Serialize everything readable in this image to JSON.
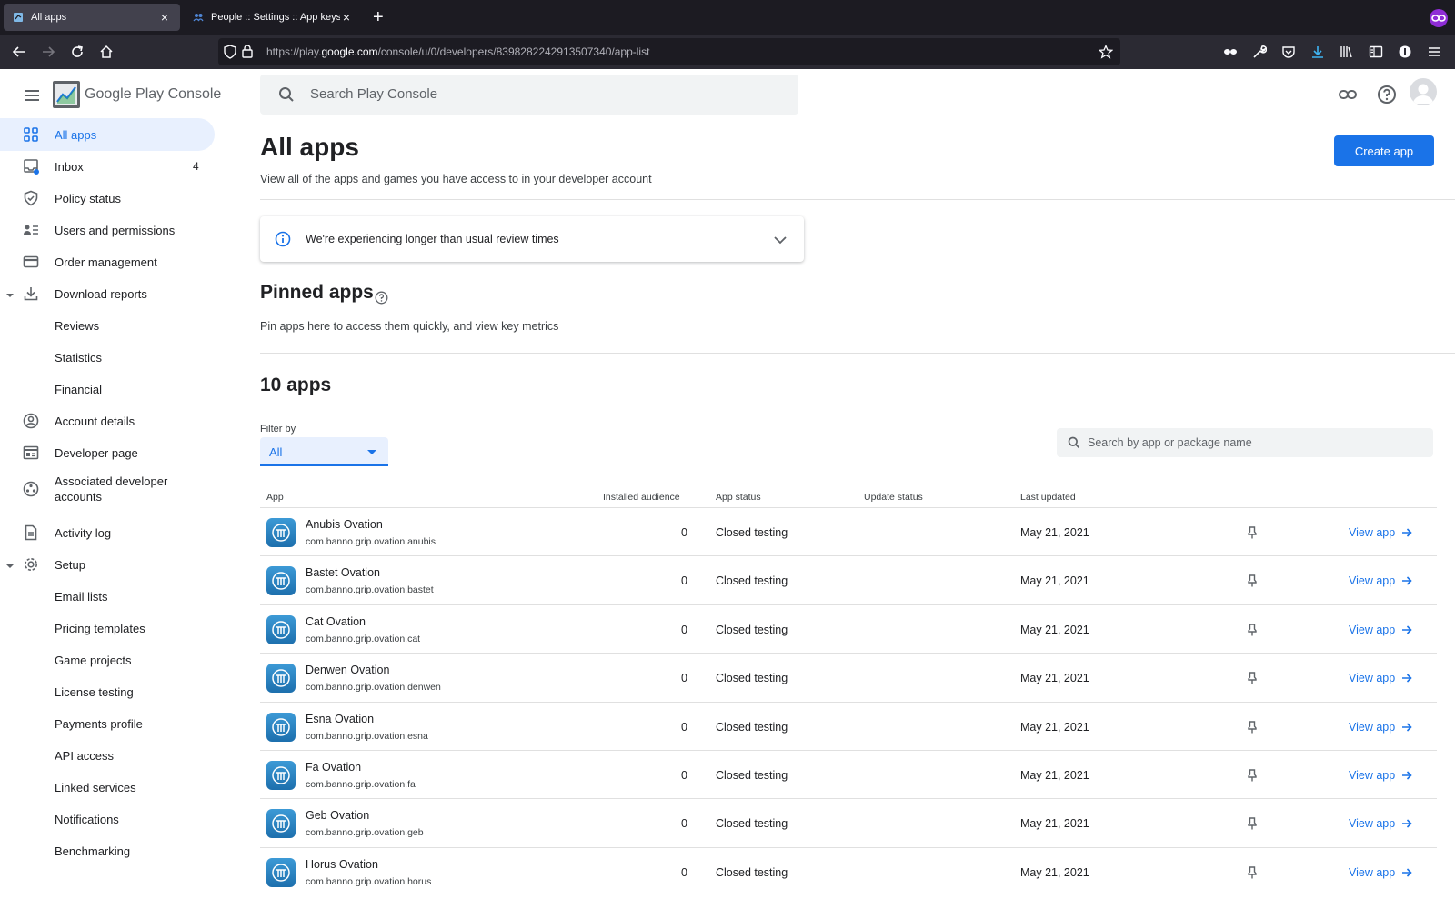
{
  "browser": {
    "tabs": [
      {
        "title": "All apps",
        "active": true
      },
      {
        "title": "People :: Settings :: App keys",
        "active": false
      }
    ],
    "url": {
      "prefix": "https://play.",
      "domain": "google.com",
      "path": "/console/u/0/developers/8398282242913507340/app-list"
    }
  },
  "header": {
    "logo_text": "Google Play Console",
    "search_placeholder": "Search Play Console"
  },
  "sidebar": {
    "items": [
      {
        "label": "All apps",
        "icon": "grid-icon",
        "active": true
      },
      {
        "label": "Inbox",
        "icon": "inbox-icon",
        "count": "4"
      },
      {
        "label": "Policy status",
        "icon": "shield-icon"
      },
      {
        "label": "Users and permissions",
        "icon": "users-icon"
      },
      {
        "label": "Order management",
        "icon": "credit-card-icon"
      },
      {
        "label": "Download reports",
        "icon": "download-icon",
        "expanded": true
      },
      {
        "label": "Reviews",
        "sub": true
      },
      {
        "label": "Statistics",
        "sub": true
      },
      {
        "label": "Financial",
        "sub": true
      },
      {
        "label": "Account details",
        "icon": "account-circle-icon"
      },
      {
        "label": "Developer page",
        "icon": "web-page-icon"
      },
      {
        "label": "Associated developer accounts",
        "icon": "associated-accounts-icon"
      },
      {
        "label": "Activity log",
        "icon": "document-icon"
      },
      {
        "label": "Setup",
        "icon": "gear-icon",
        "expanded": true
      },
      {
        "label": "Email lists",
        "sub": true
      },
      {
        "label": "Pricing templates",
        "sub": true
      },
      {
        "label": "Game projects",
        "sub": true
      },
      {
        "label": "License testing",
        "sub": true
      },
      {
        "label": "Payments profile",
        "sub": true
      },
      {
        "label": "API access",
        "sub": true
      },
      {
        "label": "Linked services",
        "sub": true
      },
      {
        "label": "Notifications",
        "sub": true
      },
      {
        "label": "Benchmarking",
        "sub": true
      }
    ]
  },
  "main": {
    "title": "All apps",
    "subtitle": "View all of the apps and games you have access to in your developer account",
    "create_button": "Create app",
    "banner": "We're experiencing longer than usual review times",
    "pinned_title": "Pinned apps",
    "pinned_subtitle": "Pin apps here to access them quickly, and view key metrics",
    "apps_count": "10 apps",
    "filter_label": "Filter by",
    "filter_value": "All",
    "table_search_placeholder": "Search by app or package name",
    "columns": [
      "App",
      "Installed audience",
      "App status",
      "Update status",
      "Last updated"
    ],
    "view_label": "View app",
    "rows": [
      {
        "name": "Anubis Ovation",
        "package": "com.banno.grip.ovation.anubis",
        "audience": "0",
        "status": "Closed testing",
        "update_status": "",
        "updated": "May 21, 2021"
      },
      {
        "name": "Bastet Ovation",
        "package": "com.banno.grip.ovation.bastet",
        "audience": "0",
        "status": "Closed testing",
        "update_status": "",
        "updated": "May 21, 2021"
      },
      {
        "name": "Cat Ovation",
        "package": "com.banno.grip.ovation.cat",
        "audience": "0",
        "status": "Closed testing",
        "update_status": "",
        "updated": "May 21, 2021"
      },
      {
        "name": "Denwen Ovation",
        "package": "com.banno.grip.ovation.denwen",
        "audience": "0",
        "status": "Closed testing",
        "update_status": "",
        "updated": "May 21, 2021"
      },
      {
        "name": "Esna Ovation",
        "package": "com.banno.grip.ovation.esna",
        "audience": "0",
        "status": "Closed testing",
        "update_status": "",
        "updated": "May 21, 2021"
      },
      {
        "name": "Fa Ovation",
        "package": "com.banno.grip.ovation.fa",
        "audience": "0",
        "status": "Closed testing",
        "update_status": "",
        "updated": "May 21, 2021"
      },
      {
        "name": "Geb Ovation",
        "package": "com.banno.grip.ovation.geb",
        "audience": "0",
        "status": "Closed testing",
        "update_status": "",
        "updated": "May 21, 2021"
      },
      {
        "name": "Horus Ovation",
        "package": "com.banno.grip.ovation.horus",
        "audience": "0",
        "status": "Closed testing",
        "update_status": "",
        "updated": "May 21, 2021"
      }
    ]
  }
}
